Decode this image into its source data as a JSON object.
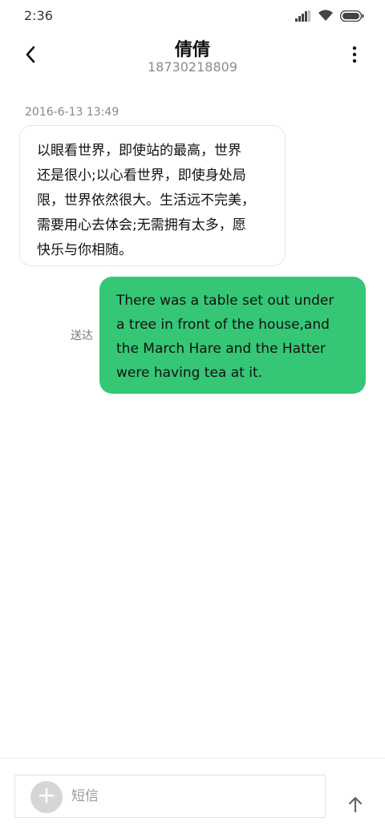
{
  "status_bar": {
    "time": "2:36",
    "icons": [
      "signal-icon",
      "wifi-icon",
      "battery-icon"
    ]
  },
  "header": {
    "contact_name": "倩倩",
    "phone_number": "18730218809",
    "icons": [
      "back-arrow-icon",
      "more-vertical-icon"
    ]
  },
  "conversation": {
    "timestamp": "2016-6-13 13:49",
    "incoming_message": {
      "lines": [
        "以眼看世界，即使站的最高，世界",
        "还是很小;以心看世界，即使身处局",
        "限，世界依然很大。生活远不完美，",
        "需要用心去体会;无需拥有太多，愿",
        "快乐与你相随。"
      ]
    },
    "outgoing_message": {
      "status": "送达",
      "lines": [
        "There was a table set out under",
        "a tree in front of the house,and",
        "the March Hare and the Hatter",
        "were having tea at it."
      ]
    }
  },
  "composer": {
    "placeholder": "短信",
    "value": "",
    "icons": [
      "add-icon",
      "send-arrow-icon"
    ]
  },
  "colors": {
    "outgoing_bubble": "#35c776",
    "incoming_border": "#e6e6e6",
    "secondary_text": "#8a8a8a"
  }
}
